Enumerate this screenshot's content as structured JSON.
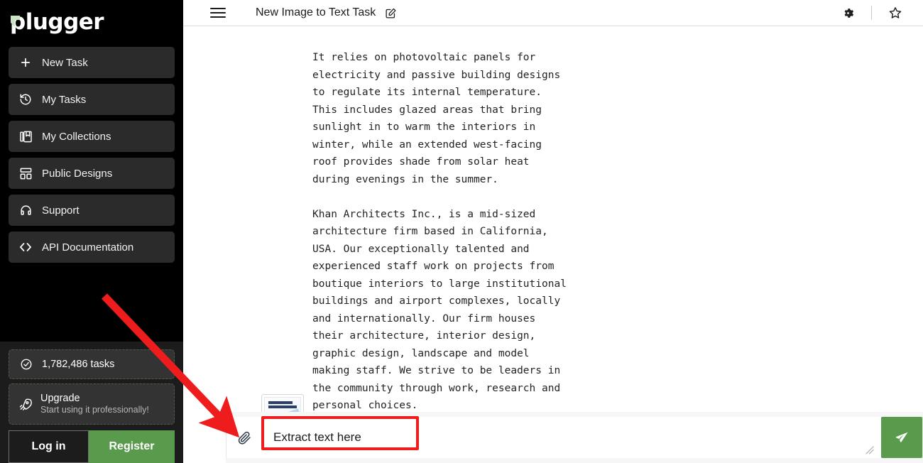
{
  "brand": {
    "name": "plugger"
  },
  "sidebar": {
    "items": [
      {
        "label": "New Task",
        "icon": "plus-icon"
      },
      {
        "label": "My Tasks",
        "icon": "history-clock-icon"
      },
      {
        "label": "My Collections",
        "icon": "collections-book-icon"
      },
      {
        "label": "Public Designs",
        "icon": "layout-grid-icon"
      },
      {
        "label": "Support",
        "icon": "headset-icon"
      },
      {
        "label": "API Documentation",
        "icon": "code-brackets-icon"
      }
    ],
    "stat": {
      "label": "1,782,486 tasks",
      "icon": "check-circle-icon"
    },
    "upgrade": {
      "title": "Upgrade",
      "subtitle": "Start using it professionally!",
      "icon": "rocket-icon"
    },
    "auth": {
      "login_label": "Log in",
      "register_label": "Register"
    }
  },
  "topbar": {
    "menu_icon": "hamburger-icon",
    "title": "New Image to Text Task",
    "edit_icon": "edit-square-icon",
    "settings_icon": "gear-icon",
    "favorite_icon": "star-icon"
  },
  "content": {
    "document_text": "It relies on photovoltaic panels for\nelectricity and passive building designs\nto regulate its internal temperature.\nThis includes glazed areas that bring\nsunlight in to warm the interiors in\nwinter, while an extended west-facing\nroof provides shade from solar heat\nduring evenings in the summer.\n\nKhan Architects Inc., is a mid-sized\narchitecture firm based in California,\nUSA. Our exceptionally talented and\nexperienced staff work on projects from\nboutique interiors to large institutional\nbuildings and airport complexes, locally\nand internationally. Our firm houses\ntheir architecture, interior design,\ngraphic design, landscape and model\nmaking staff. We strive to be leaders in\nthe community through work, research and\npersonal choices."
  },
  "composer": {
    "attachment_icon": "paperclip-icon",
    "input_value": "Extract text here",
    "input_placeholder": "Extract text here",
    "resize_icon": "resize-grip-icon",
    "send_icon": "send-plane-icon",
    "thumbnail_name": "attached-document-thumbnail"
  },
  "annotation": {
    "arrow_color": "#ee1c1c",
    "highlight_color": "#ee1c1c"
  },
  "colors": {
    "sidebar_bg": "#000000",
    "nav_item_bg": "#2b2b2b",
    "accent_green": "#5a9a4d",
    "logo_accent": "#c9e3c4"
  }
}
